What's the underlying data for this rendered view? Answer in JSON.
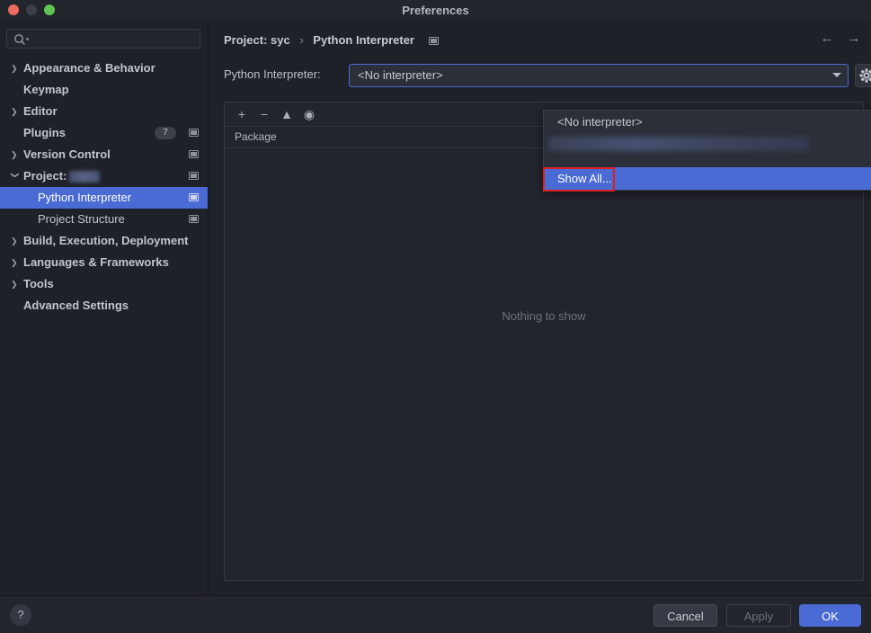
{
  "window": {
    "title": "Preferences",
    "traffic_lights": [
      "close-red",
      "minimize-gray",
      "zoom-green"
    ]
  },
  "sidebar": {
    "search": {
      "value": "",
      "placeholder": "",
      "icon": "search-icon"
    },
    "items": [
      {
        "label": "Appearance & Behavior",
        "level": 0,
        "expandable": true,
        "expanded": false,
        "selected": false,
        "badge": null,
        "project_icon": false
      },
      {
        "label": "Keymap",
        "level": 0,
        "expandable": false,
        "expanded": false,
        "selected": false,
        "badge": null,
        "project_icon": false
      },
      {
        "label": "Editor",
        "level": 0,
        "expandable": true,
        "expanded": false,
        "selected": false,
        "badge": null,
        "project_icon": false
      },
      {
        "label": "Plugins",
        "level": 0,
        "expandable": false,
        "expanded": false,
        "selected": false,
        "badge": "7",
        "project_icon": true
      },
      {
        "label": "Version Control",
        "level": 0,
        "expandable": true,
        "expanded": false,
        "selected": false,
        "badge": null,
        "project_icon": true
      },
      {
        "label": "Project:",
        "level": 0,
        "expandable": true,
        "expanded": true,
        "selected": false,
        "badge": null,
        "project_icon": true,
        "redacted_value": true
      },
      {
        "label": "Python Interpreter",
        "level": 1,
        "expandable": false,
        "expanded": false,
        "selected": true,
        "badge": null,
        "project_icon": true
      },
      {
        "label": "Project Structure",
        "level": 1,
        "expandable": false,
        "expanded": false,
        "selected": false,
        "badge": null,
        "project_icon": true
      },
      {
        "label": "Build, Execution, Deployment",
        "level": 0,
        "expandable": true,
        "expanded": false,
        "selected": false,
        "badge": null,
        "project_icon": false
      },
      {
        "label": "Languages & Frameworks",
        "level": 0,
        "expandable": true,
        "expanded": false,
        "selected": false,
        "badge": null,
        "project_icon": false
      },
      {
        "label": "Tools",
        "level": 0,
        "expandable": true,
        "expanded": false,
        "selected": false,
        "badge": null,
        "project_icon": false
      },
      {
        "label": "Advanced Settings",
        "level": 0,
        "expandable": false,
        "expanded": false,
        "selected": false,
        "badge": null,
        "project_icon": false
      }
    ]
  },
  "main": {
    "breadcrumb": {
      "root": "Project: syc",
      "separator": "›",
      "current": "Python Interpreter"
    },
    "nav": {
      "back": "←",
      "forward": "→"
    },
    "interpreter": {
      "label": "Python Interpreter:",
      "value": "<No interpreter>",
      "gear_icon": "gear-icon"
    },
    "dropdown": {
      "open": true,
      "items": [
        {
          "label": "<No interpreter>",
          "selected": false,
          "redacted": false
        },
        {
          "label": "",
          "selected": false,
          "redacted": true
        },
        {
          "label": "Show All...",
          "selected": true,
          "redacted": false,
          "annotated": true
        }
      ]
    },
    "packages": {
      "toolbar": [
        "add-icon",
        "remove-icon",
        "upgrade-icon",
        "show-early-releases-icon"
      ],
      "toolbar_glyphs": [
        "+",
        "−",
        "▲",
        "◉"
      ],
      "columns": [
        "Package"
      ],
      "rows": [],
      "empty_text": "Nothing to show"
    }
  },
  "footer": {
    "help_label": "?",
    "cancel_label": "Cancel",
    "apply_label": "Apply",
    "apply_enabled": false,
    "ok_label": "OK"
  },
  "colors": {
    "accent": "#4a6ad4",
    "window_bg": "#1e2128",
    "panel_bg": "#22252c",
    "annotation": "#e02020",
    "text": "#c2c5cb"
  }
}
